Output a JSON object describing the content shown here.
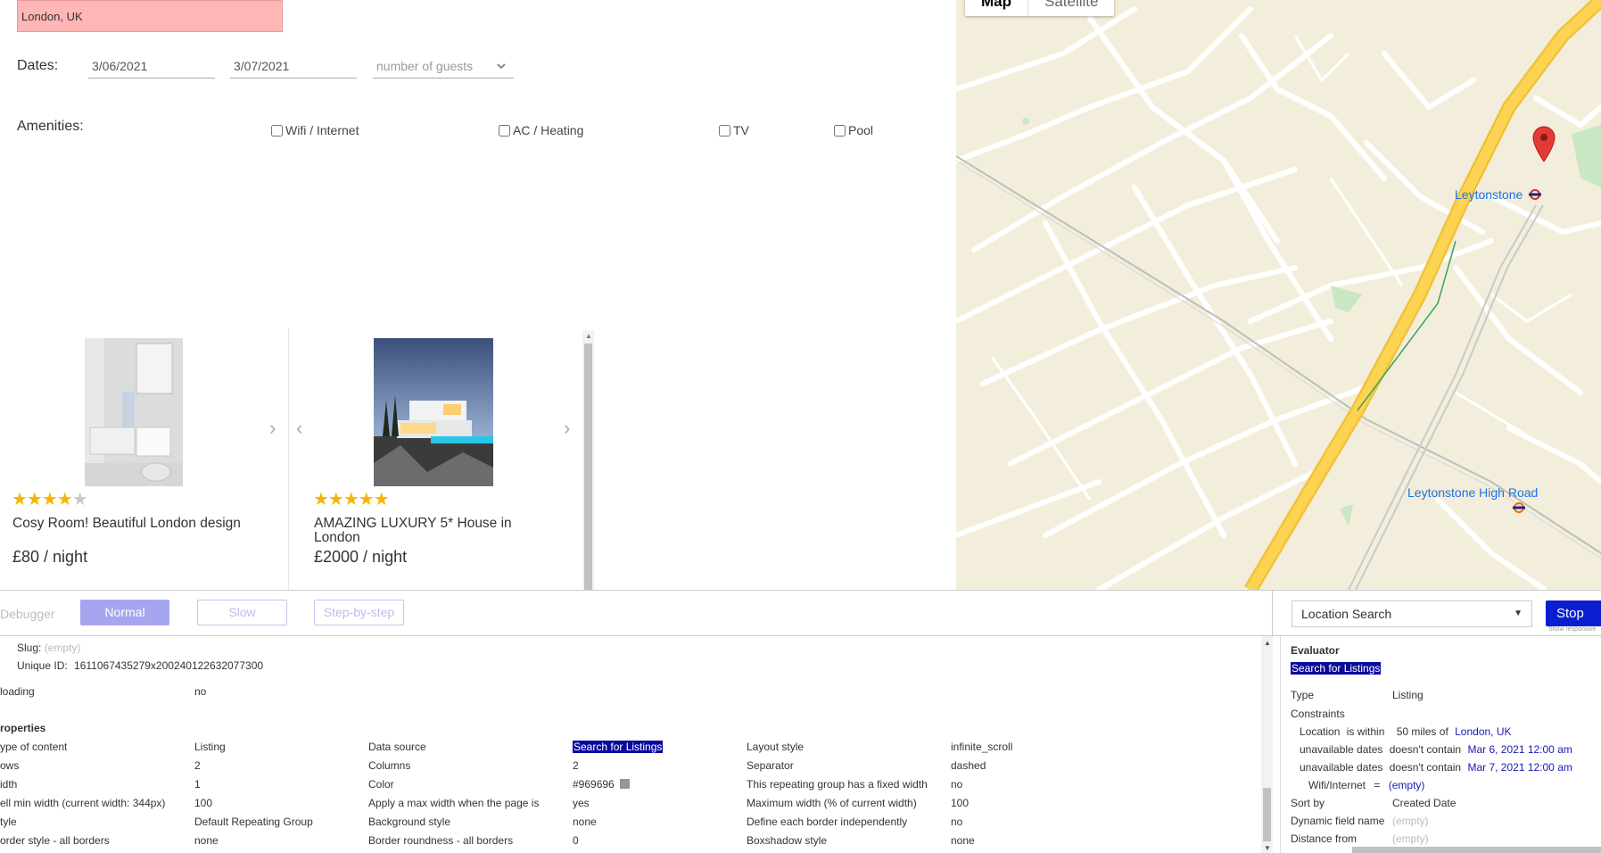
{
  "search": {
    "location_value": "London, UK",
    "dates_label": "Dates:",
    "check_in": "3/06/2021",
    "check_out": "3/07/2021",
    "guests_placeholder": "number of guests",
    "amenities_label": "Amenities:",
    "amenities": [
      "Wifi / Internet",
      "AC / Heating",
      "TV",
      "Pool"
    ]
  },
  "listings": [
    {
      "title": "Cosy Room! Beautiful London design",
      "price": "£80 / night",
      "rating": 4
    },
    {
      "title": "AMAZING LUXURY 5* House in London",
      "price": "£2000 / night",
      "rating": 5
    }
  ],
  "map": {
    "tabs": [
      "Map",
      "Satellite"
    ],
    "labels": [
      "Leytonstone",
      "Leytonstone High Road"
    ],
    "colors": {
      "land": "#f3eedb",
      "road": "#ffffff",
      "highway": "#fcd452",
      "park": "#c9e7c2",
      "marker": "#e53935"
    }
  },
  "debugger": {
    "title": "Debugger",
    "modes": [
      "Normal",
      "Slow",
      "Step-by-step"
    ],
    "active_mode": "Normal",
    "workflow_select": "Location Search",
    "stop_label": "Stop",
    "show_responsive": "Show responsive",
    "accent": "#0a1ed0"
  },
  "inspector": {
    "slug_label": "Slug:",
    "slug_value": "(empty)",
    "unique_id_label": "Unique ID:",
    "unique_id_value": "1611067435279x200240122632077300",
    "loading_label": "loading",
    "loading_value": "no",
    "properties_heading": "roperties",
    "rows": [
      [
        "ype of content",
        "Listing",
        "Data source",
        "Search for Listings",
        "Layout style",
        "infinite_scroll"
      ],
      [
        "ows",
        "2",
        "Columns",
        "2",
        "Separator",
        "dashed"
      ],
      [
        "idth",
        "1",
        "Color",
        "#969696",
        "This repeating group has a fixed width",
        "no"
      ],
      [
        "ell min width (current width: 344px)",
        "100",
        "Apply a max width when the page is",
        "yes",
        "Maximum width (% of current width)",
        "100"
      ],
      [
        "tyle",
        "Default Repeating Group",
        "Background style",
        "none",
        "Define each border independently",
        "no"
      ],
      [
        "order style - all borders",
        "none",
        "Border roundness - all borders",
        "0",
        "Boxshadow style",
        "none"
      ]
    ]
  },
  "evaluator": {
    "heading": "Evaluator",
    "expression": "Search for Listings",
    "type_label": "Type",
    "type_value": "Listing",
    "constraints_label": "Constraints",
    "constraints": [
      {
        "field": "Location",
        "op": "is within",
        "extra": "50 miles of",
        "value": "London, UK"
      },
      {
        "field": "unavailable dates",
        "op": "doesn't contain",
        "extra": "",
        "value": "Mar 6, 2021 12:00 am"
      },
      {
        "field": "unavailable dates",
        "op": "doesn't contain",
        "extra": "",
        "value": "Mar 7, 2021 12:00 am"
      },
      {
        "field": "Wifi/Internet",
        "op": "=",
        "extra": "",
        "value": "(empty)"
      }
    ],
    "sort_label": "Sort by",
    "sort_value": "Created Date",
    "dyn_label": "Dynamic field name",
    "dyn_value": "(empty)",
    "dist_label": "Distance from",
    "dist_value": "(empty)"
  }
}
